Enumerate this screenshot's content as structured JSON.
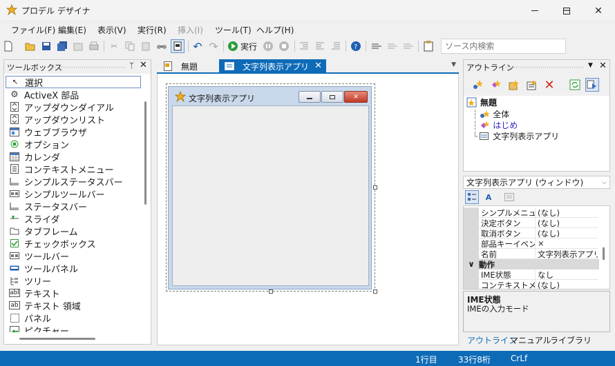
{
  "window": {
    "title": "プロデル デザイナ",
    "controls": [
      "minimize",
      "maximize",
      "close"
    ]
  },
  "menu": [
    "ファイル(F)",
    "編集(E)",
    "表示(V)",
    "実行(R)",
    "挿入(I)",
    "ツール(T)",
    "ヘルプ(H)"
  ],
  "menu_disabled": [
    "挿入(I)"
  ],
  "toolbar": {
    "run_label": "実行",
    "search_placeholder": "ソース内検索"
  },
  "toolbox": {
    "title": "ツールボックス",
    "items": [
      "選択",
      "ActiveX 部品",
      "アップダウンダイアル",
      "アップダウンリスト",
      "ウェブブラウザ",
      "オプション",
      "カレンダ",
      "コンテキストメニュー",
      "シンプルステータスバー",
      "シンプルツールバー",
      "ステータスバー",
      "スライダ",
      "タブフレーム",
      "チェックボックス",
      "ツールバー",
      "ツールパネル",
      "ツリー",
      "テキスト",
      "テキスト 領域",
      "パネル",
      "ピクチャー"
    ]
  },
  "tabs": [
    {
      "label": "無題",
      "active": false
    },
    {
      "label": "文字列表示アプリ",
      "active": true
    }
  ],
  "form": {
    "title": "文字列表示アプリ"
  },
  "outline": {
    "title": "アウトライン",
    "tree": [
      "無題",
      "全体",
      "はじめ",
      "文字列表示アプリ"
    ]
  },
  "object_selector": "文字列表示アプリ (ウィンドウ)",
  "properties": [
    {
      "key": "シンプルメニュー",
      "value": "(なし)"
    },
    {
      "key": "決定ボタン",
      "value": "(なし)"
    },
    {
      "key": "取消ボタン",
      "value": "(なし)"
    },
    {
      "key": "部品キーイベント",
      "value": "×"
    },
    {
      "key": "名前",
      "value": "文字列表示アプリ"
    },
    {
      "category": "動作"
    },
    {
      "key": "IME状態",
      "value": "なし"
    },
    {
      "key": "コンテキストメニュ",
      "value": "(なし)"
    }
  ],
  "description": {
    "title": "IME状態",
    "text": "IMEの入力モード"
  },
  "right_tabs": [
    "アウトライン",
    "マニュアル",
    "ライブラリ"
  ],
  "status": {
    "line": "1行目",
    "position": "33行8桁",
    "eol": "CrLf"
  },
  "colors": {
    "accent": "#0e6bb8",
    "selection": "#6d8fc4"
  }
}
